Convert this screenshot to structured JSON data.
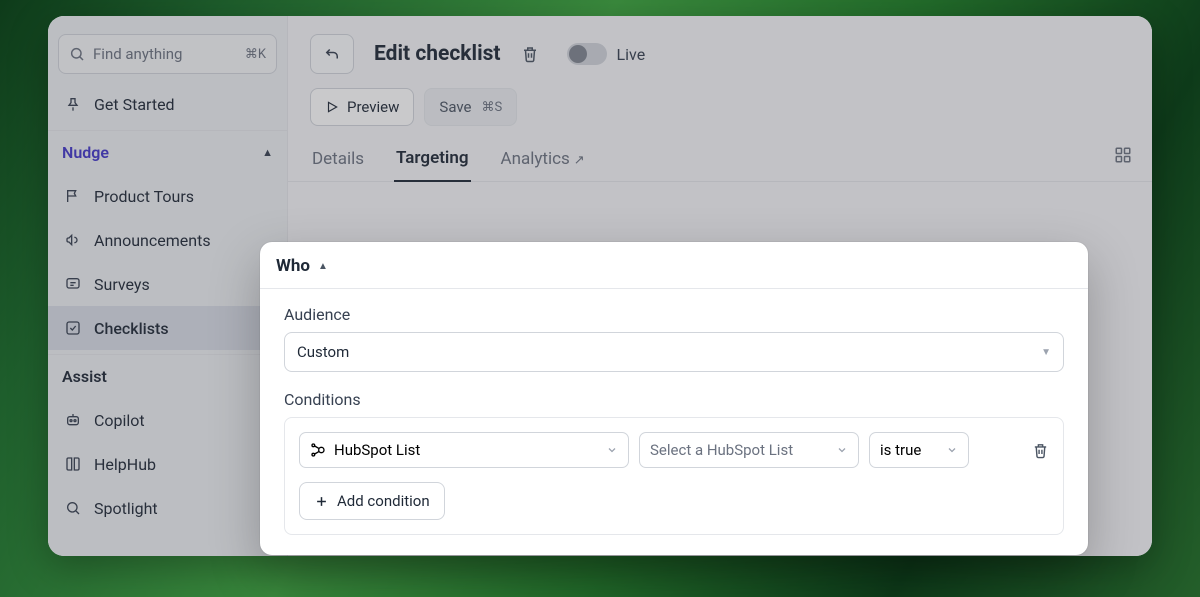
{
  "search": {
    "placeholder": "Find anything",
    "shortcut": "⌘K"
  },
  "sidebar": {
    "get_started": "Get Started",
    "nudge_label": "Nudge",
    "nudge_items": [
      "Product Tours",
      "Announcements",
      "Surveys",
      "Checklists"
    ],
    "assist_label": "Assist",
    "assist_items": [
      "Copilot",
      "HelpHub",
      "Spotlight"
    ]
  },
  "topbar": {
    "title": "Edit checklist",
    "toggle_label": "Live",
    "preview": "Preview",
    "save": "Save",
    "save_shortcut": "⌘S"
  },
  "tabs": {
    "details": "Details",
    "targeting": "Targeting",
    "analytics": "Analytics"
  },
  "panel": {
    "title": "Who",
    "audience_label": "Audience",
    "audience_value": "Custom",
    "conditions_label": "Conditions",
    "property": "HubSpot List",
    "value_placeholder": "Select a HubSpot List",
    "operator": "is true",
    "add_condition": "Add condition"
  }
}
